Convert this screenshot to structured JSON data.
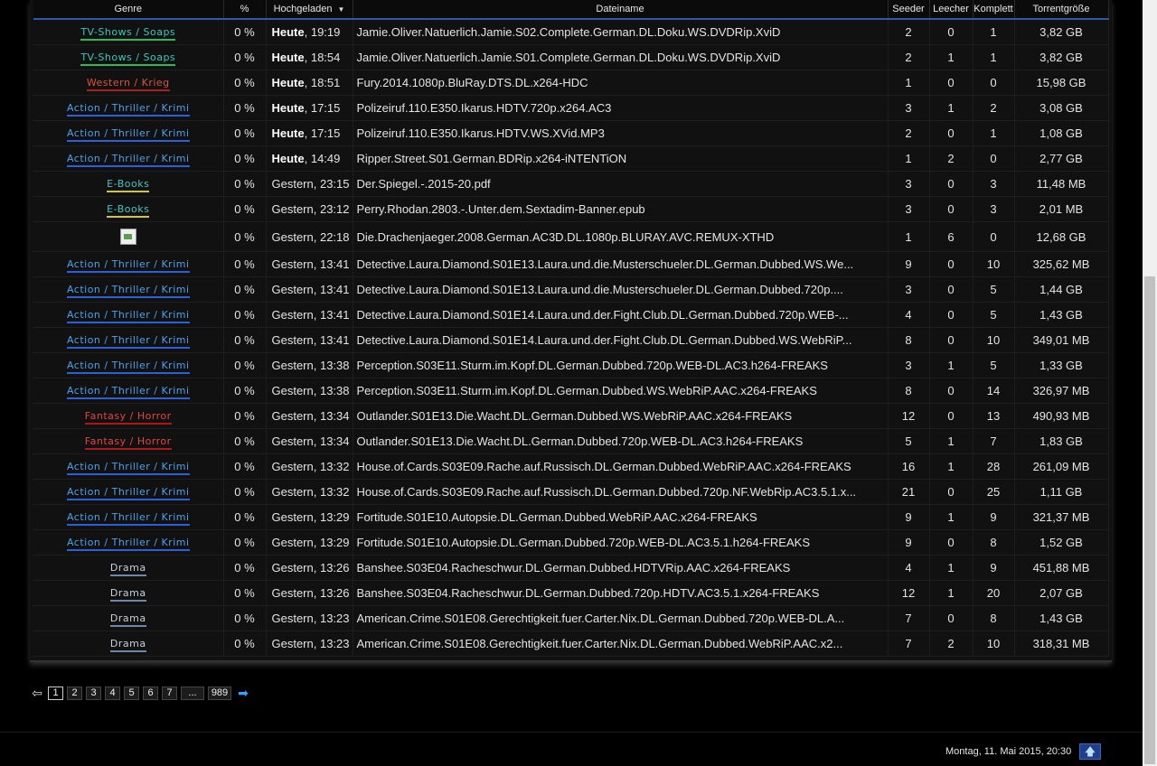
{
  "table": {
    "headers": {
      "genre": "Genre",
      "percent": "%",
      "uploaded": "Hochgeladen",
      "filename": "Dateiname",
      "seeder": "Seeder",
      "leecher": "Leecher",
      "complete": "Komplett",
      "size": "Torrentgröße"
    },
    "rows": [
      {
        "genre": "TV-Shows / Soaps",
        "genre_style": "g-tv",
        "percent": "0 %",
        "date_bold": "Heute",
        "date_rest": ", 19:19",
        "name": "Jamie.Oliver.Natuerlich.Jamie.S02.Complete.German.DL.Doku.WS.DVDRip.XviD",
        "seeder": "2",
        "leecher": "0",
        "complete": "1",
        "size": "3,82 GB"
      },
      {
        "genre": "TV-Shows / Soaps",
        "genre_style": "g-tv",
        "percent": "0 %",
        "date_bold": "Heute",
        "date_rest": ", 18:54",
        "name": "Jamie.Oliver.Natuerlich.Jamie.S01.Complete.German.DL.Doku.WS.DVDRip.XviD",
        "seeder": "2",
        "leecher": "1",
        "complete": "1",
        "size": "3,82 GB"
      },
      {
        "genre": "Western / Krieg",
        "genre_style": "g-western",
        "percent": "0 %",
        "date_bold": "Heute",
        "date_rest": ", 18:51",
        "name": "Fury.2014.1080p.BluRay.DTS.DL.x264-HDC",
        "seeder": "1",
        "leecher": "0",
        "complete": "0",
        "size": "15,98 GB"
      },
      {
        "genre": "Action / Thriller / Krimi",
        "genre_style": "g-action",
        "percent": "0 %",
        "date_bold": "Heute",
        "date_rest": ", 17:15",
        "name": "Polizeiruf.110.E350.Ikarus.HDTV.720p.x264.AC3",
        "seeder": "3",
        "leecher": "1",
        "complete": "2",
        "size": "3,08 GB"
      },
      {
        "genre": "Action / Thriller / Krimi",
        "genre_style": "g-action",
        "percent": "0 %",
        "date_bold": "Heute",
        "date_rest": ", 17:15",
        "name": "Polizeiruf.110.E350.Ikarus.HDTV.WS.XVid.MP3",
        "seeder": "2",
        "leecher": "0",
        "complete": "1",
        "size": "1,08 GB"
      },
      {
        "genre": "Action / Thriller / Krimi",
        "genre_style": "g-action",
        "percent": "0 %",
        "date_bold": "Heute",
        "date_rest": ", 14:49",
        "name": "Ripper.Street.S01.German.BDRip.x264-iNTENTiON",
        "seeder": "1",
        "leecher": "2",
        "complete": "0",
        "size": "2,77 GB"
      },
      {
        "genre": "E-Books",
        "genre_style": "g-ebooks",
        "percent": "0 %",
        "date_bold": "",
        "date_rest": "Gestern, 23:15",
        "name": "Der.Spiegel.-.2015-20.pdf",
        "seeder": "3",
        "leecher": "0",
        "complete": "3",
        "size": "11,48 MB"
      },
      {
        "genre": "E-Books",
        "genre_style": "g-ebooks",
        "percent": "0 %",
        "date_bold": "",
        "date_rest": "Gestern, 23:12",
        "name": "Perry.Rhodan.2803.-.Unter.dem.Sextadim-Banner.epub",
        "seeder": "3",
        "leecher": "0",
        "complete": "3",
        "size": "2,01 MB"
      },
      {
        "genre": "",
        "genre_style": "broken",
        "percent": "0 %",
        "date_bold": "",
        "date_rest": "Gestern, 22:18",
        "name": "Die.Drachenjaeger.2008.German.AC3D.DL.1080p.BLURAY.AVC.REMUX-XTHD",
        "seeder": "1",
        "leecher": "6",
        "complete": "0",
        "size": "12,68 GB"
      },
      {
        "genre": "Action / Thriller / Krimi",
        "genre_style": "g-action",
        "percent": "0 %",
        "date_bold": "",
        "date_rest": "Gestern, 13:41",
        "name": "Detective.Laura.Diamond.S01E13.Laura.und.die.Musterschueler.DL.German.Dubbed.WS.We...",
        "seeder": "9",
        "leecher": "0",
        "complete": "10",
        "size": "325,62 MB"
      },
      {
        "genre": "Action / Thriller / Krimi",
        "genre_style": "g-action",
        "percent": "0 %",
        "date_bold": "",
        "date_rest": "Gestern, 13:41",
        "name": "Detective.Laura.Diamond.S01E13.Laura.und.die.Musterschueler.DL.German.Dubbed.720p....",
        "seeder": "3",
        "leecher": "0",
        "complete": "5",
        "size": "1,44 GB"
      },
      {
        "genre": "Action / Thriller / Krimi",
        "genre_style": "g-action",
        "percent": "0 %",
        "date_bold": "",
        "date_rest": "Gestern, 13:41",
        "name": "Detective.Laura.Diamond.S01E14.Laura.und.der.Fight.Club.DL.German.Dubbed.720p.WEB-...",
        "seeder": "4",
        "leecher": "0",
        "complete": "5",
        "size": "1,43 GB"
      },
      {
        "genre": "Action / Thriller / Krimi",
        "genre_style": "g-action",
        "percent": "0 %",
        "date_bold": "",
        "date_rest": "Gestern, 13:41",
        "name": "Detective.Laura.Diamond.S01E14.Laura.und.der.Fight.Club.DL.German.Dubbed.WS.WebRiP...",
        "seeder": "8",
        "leecher": "0",
        "complete": "10",
        "size": "349,01 MB"
      },
      {
        "genre": "Action / Thriller / Krimi",
        "genre_style": "g-action",
        "percent": "0 %",
        "date_bold": "",
        "date_rest": "Gestern, 13:38",
        "name": "Perception.S03E11.Sturm.im.Kopf.DL.German.Dubbed.720p.WEB-DL.AC3.h264-FREAKS",
        "seeder": "3",
        "leecher": "1",
        "complete": "5",
        "size": "1,33 GB"
      },
      {
        "genre": "Action / Thriller / Krimi",
        "genre_style": "g-action",
        "percent": "0 %",
        "date_bold": "",
        "date_rest": "Gestern, 13:38",
        "name": "Perception.S03E11.Sturm.im.Kopf.DL.German.Dubbed.WS.WebRiP.AAC.x264-FREAKS",
        "seeder": "8",
        "leecher": "0",
        "complete": "14",
        "size": "326,97 MB"
      },
      {
        "genre": "Fantasy / Horror",
        "genre_style": "g-fantasy",
        "percent": "0 %",
        "date_bold": "",
        "date_rest": "Gestern, 13:34",
        "name": "Outlander.S01E13.Die.Wacht.DL.German.Dubbed.WS.WebRiP.AAC.x264-FREAKS",
        "seeder": "12",
        "leecher": "0",
        "complete": "13",
        "size": "490,93 MB"
      },
      {
        "genre": "Fantasy / Horror",
        "genre_style": "g-fantasy",
        "percent": "0 %",
        "date_bold": "",
        "date_rest": "Gestern, 13:34",
        "name": "Outlander.S01E13.Die.Wacht.DL.German.Dubbed.720p.WEB-DL.AC3.h264-FREAKS",
        "seeder": "5",
        "leecher": "1",
        "complete": "7",
        "size": "1,83 GB"
      },
      {
        "genre": "Action / Thriller / Krimi",
        "genre_style": "g-action",
        "percent": "0 %",
        "date_bold": "",
        "date_rest": "Gestern, 13:32",
        "name": "House.of.Cards.S03E09.Rache.auf.Russisch.DL.German.Dubbed.WebRiP.AAC.x264-FREAKS",
        "seeder": "16",
        "leecher": "1",
        "complete": "28",
        "size": "261,09 MB"
      },
      {
        "genre": "Action / Thriller / Krimi",
        "genre_style": "g-action",
        "percent": "0 %",
        "date_bold": "",
        "date_rest": "Gestern, 13:32",
        "name": "House.of.Cards.S03E09.Rache.auf.Russisch.DL.German.Dubbed.720p.NF.WebRip.AC3.5.1.x...",
        "seeder": "21",
        "leecher": "0",
        "complete": "25",
        "size": "1,11 GB"
      },
      {
        "genre": "Action / Thriller / Krimi",
        "genre_style": "g-action",
        "percent": "0 %",
        "date_bold": "",
        "date_rest": "Gestern, 13:29",
        "name": "Fortitude.S01E10.Autopsie.DL.German.Dubbed.WebRiP.AAC.x264-FREAKS",
        "seeder": "9",
        "leecher": "1",
        "complete": "9",
        "size": "321,37 MB"
      },
      {
        "genre": "Action / Thriller / Krimi",
        "genre_style": "g-action",
        "percent": "0 %",
        "date_bold": "",
        "date_rest": "Gestern, 13:29",
        "name": "Fortitude.S01E10.Autopsie.DL.German.Dubbed.720p.WEB-DL.AC3.5.1.h264-FREAKS",
        "seeder": "9",
        "leecher": "0",
        "complete": "8",
        "size": "1,52 GB"
      },
      {
        "genre": "Drama",
        "genre_style": "g-drama",
        "percent": "0 %",
        "date_bold": "",
        "date_rest": "Gestern, 13:26",
        "name": "Banshee.S03E04.Racheschwur.DL.German.Dubbed.HDTVRip.AAC.x264-FREAKS",
        "seeder": "4",
        "leecher": "1",
        "complete": "9",
        "size": "451,88 MB"
      },
      {
        "genre": "Drama",
        "genre_style": "g-drama",
        "percent": "0 %",
        "date_bold": "",
        "date_rest": "Gestern, 13:26",
        "name": "Banshee.S03E04.Racheschwur.DL.German.Dubbed.720p.HDTV.AC3.5.1.x264-FREAKS",
        "seeder": "12",
        "leecher": "1",
        "complete": "20",
        "size": "2,07 GB"
      },
      {
        "genre": "Drama",
        "genre_style": "g-drama",
        "percent": "0 %",
        "date_bold": "",
        "date_rest": "Gestern, 13:23",
        "name": "American.Crime.S01E08.Gerechtigkeit.fuer.Carter.Nix.DL.German.Dubbed.720p.WEB-DL.A...",
        "seeder": "7",
        "leecher": "0",
        "complete": "8",
        "size": "1,43 GB"
      },
      {
        "genre": "Drama",
        "genre_style": "g-drama",
        "percent": "0 %",
        "date_bold": "",
        "date_rest": "Gestern, 13:23",
        "name": "American.Crime.S01E08.Gerechtigkeit.fuer.Carter.Nix.DL.German.Dubbed.WebRiP.AAC.x2...",
        "seeder": "7",
        "leecher": "2",
        "complete": "10",
        "size": "318,31 MB"
      }
    ]
  },
  "pagination": {
    "prev_icon": "arrow-left-icon",
    "pages": [
      "1",
      "2",
      "3",
      "4",
      "5",
      "6",
      "7"
    ],
    "active": "1",
    "ellipsis": "...",
    "last": "989",
    "next_icon": "arrow-right-icon"
  },
  "footer": {
    "datetime": "Montag, 11. Mai 2015, 20:30",
    "top_icon": "arrow-up-icon"
  },
  "colors": {
    "link_blue": "#2f6fe8",
    "header_underline": "#2b5aa8",
    "background": "#000000"
  }
}
